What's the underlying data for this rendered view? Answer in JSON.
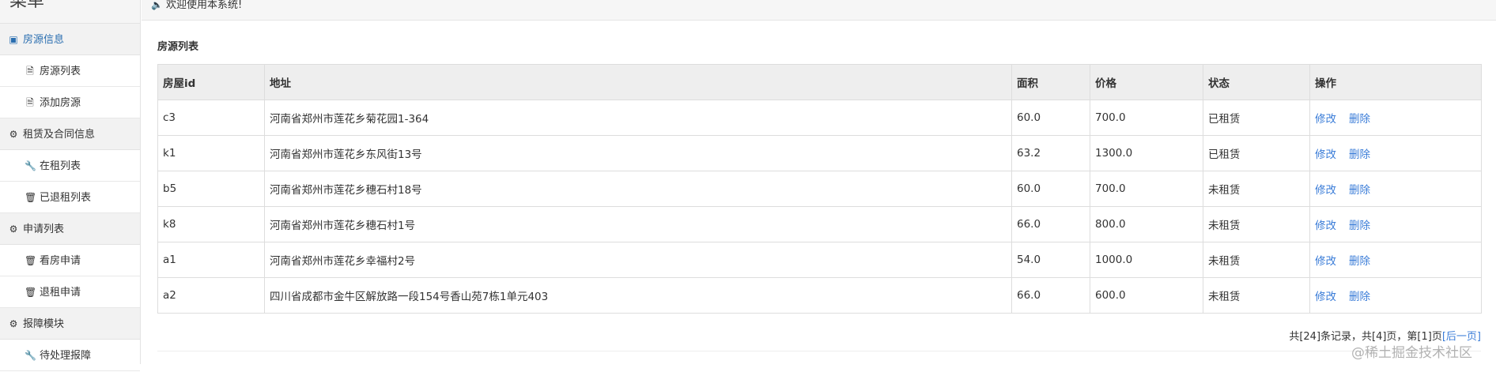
{
  "sidebar": {
    "title": "菜单",
    "groups": [
      {
        "label": "房源信息",
        "icon": "edit-square-icon",
        "items": [
          {
            "label": "房源列表",
            "icon": "file-icon"
          },
          {
            "label": "添加房源",
            "icon": "file-icon"
          }
        ]
      },
      {
        "label": "租赁及合同信息",
        "icon": "gear-icon",
        "items": [
          {
            "label": "在租列表",
            "icon": "wrench-icon"
          },
          {
            "label": "已退租列表",
            "icon": "trash-icon"
          }
        ]
      },
      {
        "label": "申请列表",
        "icon": "gear-icon",
        "items": [
          {
            "label": "看房申请",
            "icon": "trash-icon"
          },
          {
            "label": "退租申请",
            "icon": "trash-icon"
          }
        ]
      },
      {
        "label": "报障模块",
        "icon": "gear-icon",
        "items": [
          {
            "label": "待处理报障",
            "icon": "wrench-icon"
          }
        ]
      }
    ]
  },
  "topbar": {
    "welcome": "欢迎使用本系统!",
    "icon": "speaker-icon"
  },
  "main": {
    "panel_title": "房源列表",
    "columns": [
      "房屋id",
      "地址",
      "面积",
      "价格",
      "状态",
      "操作"
    ],
    "rows": [
      {
        "id": "c3",
        "address": "河南省郑州市莲花乡菊花园1-364",
        "area": "60.0",
        "price": "700.0",
        "status": "已租赁"
      },
      {
        "id": "k1",
        "address": "河南省郑州市莲花乡东风街13号",
        "area": "63.2",
        "price": "1300.0",
        "status": "已租赁"
      },
      {
        "id": "b5",
        "address": "河南省郑州市莲花乡穗石村18号",
        "area": "60.0",
        "price": "700.0",
        "status": "未租赁"
      },
      {
        "id": "k8",
        "address": "河南省郑州市莲花乡穗石村1号",
        "area": "66.0",
        "price": "800.0",
        "status": "未租赁"
      },
      {
        "id": "a1",
        "address": "河南省郑州市莲花乡幸福村2号",
        "area": "54.0",
        "price": "1000.0",
        "status": "未租赁"
      },
      {
        "id": "a2",
        "address": "四川省成都市金牛区解放路一段154号香山苑7栋1单元403",
        "area": "66.0",
        "price": "600.0",
        "status": "未租赁"
      }
    ],
    "edit_label": "修改",
    "delete_label": "删除",
    "pager": {
      "summary": "共[24]条记录，共[4]页，第[1]页",
      "next": "[后一页]"
    }
  },
  "watermark": "@稀土掘金技术社区",
  "colors": {
    "link": "#3b7dd8",
    "active_menu": "#2a6eb0",
    "header_bg": "#eeeeee"
  }
}
